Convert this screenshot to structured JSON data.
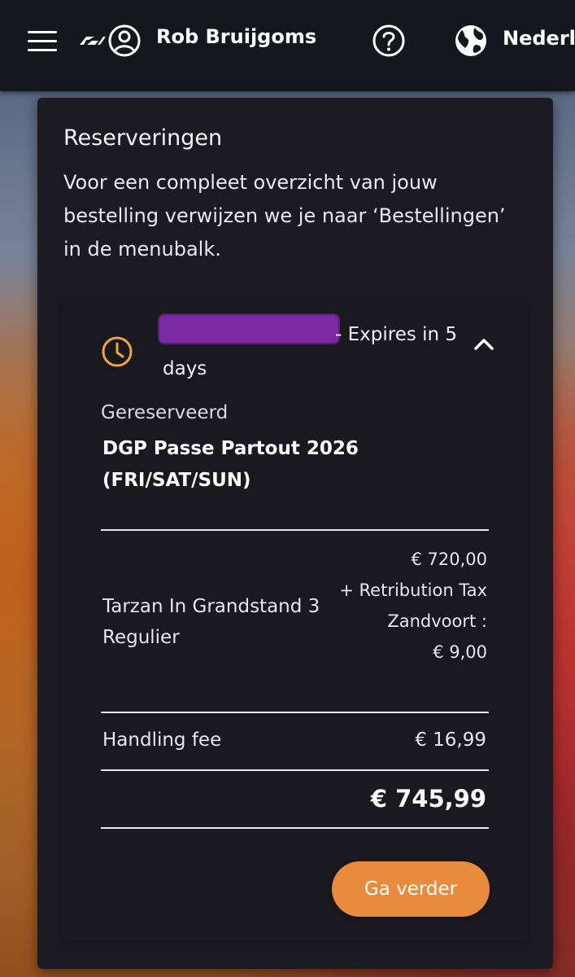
{
  "header": {
    "user_name": "Rob Bruijgoms",
    "language_label": "Nederla",
    "icons": [
      "hamburger-menu-icon",
      "f1-logo",
      "user-icon",
      "help-icon",
      "globe-icon"
    ]
  },
  "reservations": {
    "title": "Reserveringen",
    "description": "Voor een compleet overzicht van jouw bestelling verwijzen we je naar ‘Bestellingen’ in de menubalk.",
    "card": {
      "expires_text": "- Expires in 5 days",
      "status": "Gereserveerd",
      "product_name": "DGP Passe Partout 2026 (FRI/SAT/SUN)",
      "line_item": {
        "name": "Tarzan In Grandstand 3 Regulier",
        "price": "€ 720,00",
        "tax_label": "+ Retribution Tax Zandvoort :",
        "tax_value": "€ 9,00"
      },
      "handling_fee_label": "Handling fee",
      "handling_fee_value": "€ 16,99",
      "total": "€ 745,99",
      "continue_button": "Ga verder"
    }
  },
  "colors": {
    "accent": "#e98b3d",
    "clock_icon": "#f0a53a",
    "redaction": "#7b2aa3",
    "panel_bg": "#1c1b24",
    "header_bg": "#16161f"
  }
}
